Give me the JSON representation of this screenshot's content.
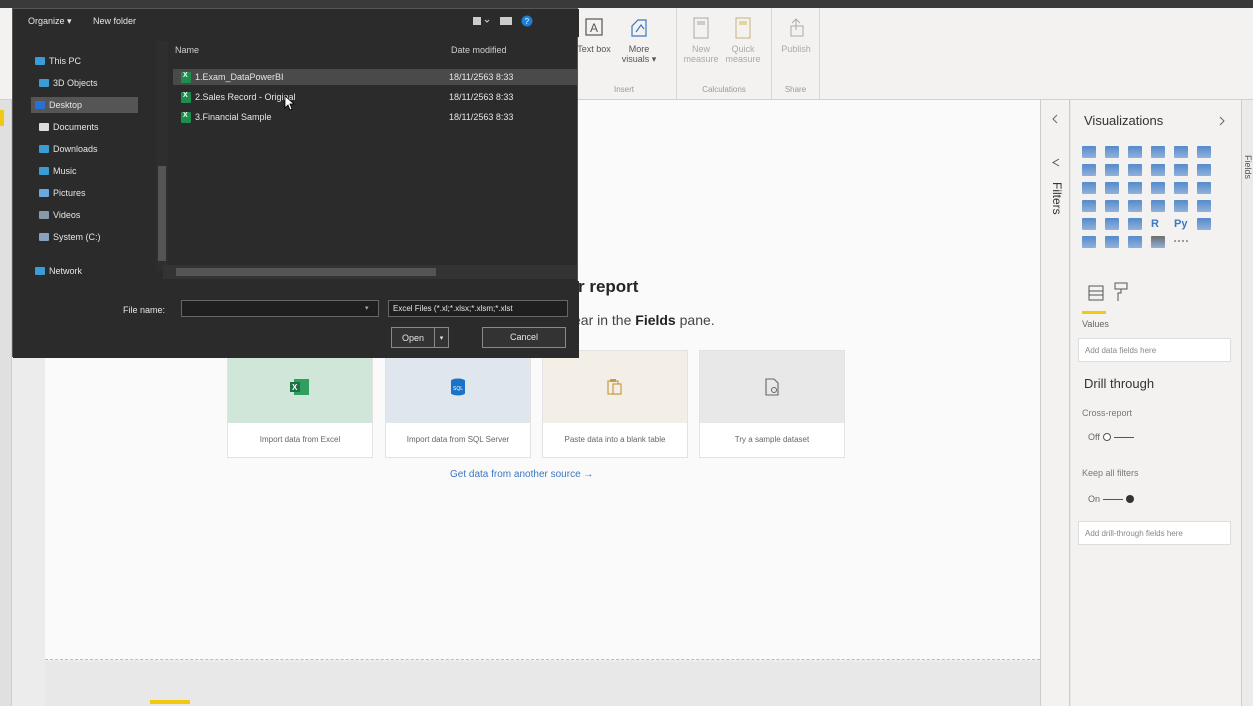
{
  "dialog": {
    "toolbar": {
      "organize": "Organize ▾",
      "new_folder": "New folder"
    },
    "nav": [
      {
        "label": "This PC",
        "icon": "computer-icon"
      },
      {
        "label": "3D Objects",
        "icon": "cube-icon"
      },
      {
        "label": "Desktop",
        "icon": "desktop-icon",
        "selected": true
      },
      {
        "label": "Documents",
        "icon": "documents-icon"
      },
      {
        "label": "Downloads",
        "icon": "download-icon"
      },
      {
        "label": "Music",
        "icon": "music-icon"
      },
      {
        "label": "Pictures",
        "icon": "pictures-icon"
      },
      {
        "label": "Videos",
        "icon": "videos-icon"
      },
      {
        "label": "System (C:)",
        "icon": "drive-icon"
      },
      {
        "label": "Network",
        "icon": "network-icon"
      }
    ],
    "columns": {
      "name": "Name",
      "date": "Date modified"
    },
    "files": [
      {
        "name": "1.Exam_DataPowerBI",
        "date": "18/11/2563 8:33",
        "selected": true
      },
      {
        "name": "2.Sales Record - Original",
        "date": "18/11/2563 8:33"
      },
      {
        "name": "3.Financial Sample",
        "date": "18/11/2563 8:33"
      }
    ],
    "file_name_label": "File name:",
    "file_name_value": "",
    "file_type_filter": "Excel Files (*.xl;*.xlsx;*.xlsm;*.xlst",
    "open_label": "Open",
    "cancel_label": "Cancel"
  },
  "ribbon": {
    "insert": {
      "text_box": "Text box",
      "more_visuals": "More visuals ▾",
      "group": "Insert"
    },
    "calculations": {
      "new_measure": "New measure",
      "quick_measure": "Quick measure",
      "group": "Calculations"
    },
    "share": {
      "publish": "Publish",
      "group": "Share"
    }
  },
  "canvas": {
    "title_fragment": "r report",
    "subtitle_pre": "ear in the ",
    "subtitle_bold": "Fields",
    "subtitle_post": " pane.",
    "cards": [
      {
        "label": "Import data from Excel",
        "icon": "excel-icon",
        "bg": "#cfe6d8"
      },
      {
        "label": "Import data from SQL Server",
        "icon": "sql-server-icon",
        "bg": "#dfe6ee"
      },
      {
        "label": "Paste data into a blank table",
        "icon": "paste-icon",
        "bg": "#f4efe6"
      },
      {
        "label": "Try a sample dataset",
        "icon": "sample-dataset-icon",
        "bg": "#e8e8e8"
      }
    ],
    "get_data_link": "Get data from another source →"
  },
  "panes": {
    "filters": "Filters",
    "fields": "Fields",
    "visualizations": {
      "title": "Visualizations",
      "values_label": "Values",
      "values_placeholder": "Add data fields here",
      "drill_title": "Drill through",
      "cross_report": "Cross-report",
      "cross_report_state": "Off",
      "keep_filters": "Keep all filters",
      "keep_filters_state": "On",
      "drill_placeholder": "Add drill-through fields here"
    }
  },
  "colors": {
    "accent": "#f2c811",
    "excel_green": "#1e8e4e",
    "link_blue": "#3a78c3"
  }
}
